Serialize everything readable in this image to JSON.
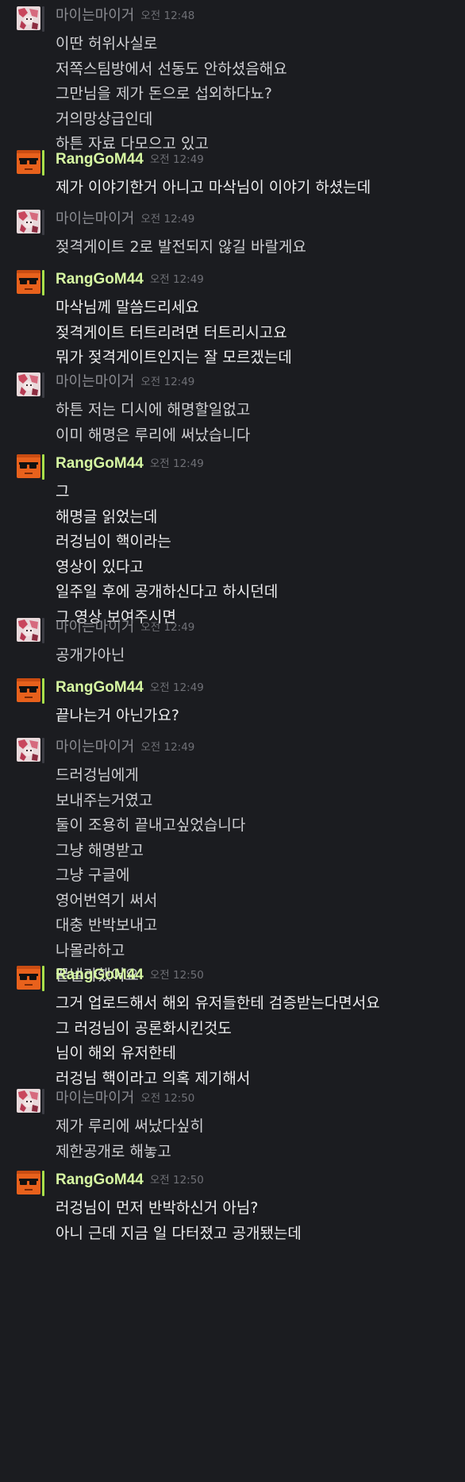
{
  "users": {
    "a": {
      "name": "마이는마이거",
      "avatar_icon": "anime-girl-avatar-icon"
    },
    "b": {
      "name": "RangGoM44",
      "avatar_icon": "sunglasses-avatar-icon"
    }
  },
  "colors": {
    "background": "#1b1c20",
    "user_a_name": "#8b8c92",
    "user_b_name": "#d6f7a2",
    "user_b_accent_bar": "#a8e04a",
    "timestamp": "#6f7076"
  },
  "messages": [
    {
      "user": "a",
      "time": "오전 12:48",
      "lines": [
        "이딴 허위사실로",
        "저쪽스팀방에서 선동도 안하셨음해요",
        "그만님을 제가 돈으로 섭외하다뇨?",
        "거의망상급인데",
        "하튼 자료 다모으고 있고"
      ]
    },
    {
      "user": "b",
      "time": "오전 12:49",
      "lines": [
        "제가 이야기한거 아니고 마삭님이 이야기 하셨는데"
      ]
    },
    {
      "user": "a",
      "time": "오전 12:49",
      "lines": [
        "젖격게이트 2로 발전되지 않길 바랄게요"
      ]
    },
    {
      "user": "b",
      "time": "오전 12:49",
      "lines": [
        "마삭님께 말씀드리세요",
        "젖격게이트 터트리려면 터트리시고요",
        "뭐가 젖격게이트인지는 잘 모르겠는데"
      ]
    },
    {
      "user": "a",
      "time": "오전 12:49",
      "lines": [
        "하튼 저는 디시에 해명할일없고",
        "이미 해명은 루리에 써났습니다"
      ]
    },
    {
      "user": "b",
      "time": "오전 12:49",
      "lines": [
        "그",
        "해명글 읽었는데",
        "러겅님이 핵이라는",
        "영상이 있다고",
        "일주일 후에 공개하신다고 하시던데",
        "그 영상 보여주시면"
      ]
    },
    {
      "user": "a",
      "time": "오전 12:49",
      "lines": [
        "공개가아닌"
      ]
    },
    {
      "user": "b",
      "time": "오전 12:49",
      "lines": [
        "끝나는거 아닌가요?"
      ]
    },
    {
      "user": "a",
      "time": "오전 12:49",
      "lines": [
        "드러겅님에게",
        "보내주는거였고",
        "둘이 조용히 끝내고싶었습니다",
        "그냥 해명받고",
        "그냥 구글에",
        "영어번역기 써서",
        "대충 반박보내고",
        "나몰라하고",
        "끝낼라했어요"
      ]
    },
    {
      "user": "b",
      "time": "오전 12:50",
      "lines": [
        "그거 업로드해서 해외 유저들한테 검증받는다면서요",
        "그 러겅님이 공론화시킨것도",
        "님이 해외 유저한테",
        "러겅님 핵이라고 의혹 제기해서"
      ]
    },
    {
      "user": "a",
      "time": "오전 12:50",
      "lines": [
        "제가 루리에 써났다싶히",
        "제한공개로 해놓고"
      ]
    },
    {
      "user": "b",
      "time": "오전 12:50",
      "lines": [
        "러겅님이 먼저 반박하신거 아님?",
        "아니 근데 지금 일 다터졌고 공개됐는데"
      ]
    }
  ]
}
